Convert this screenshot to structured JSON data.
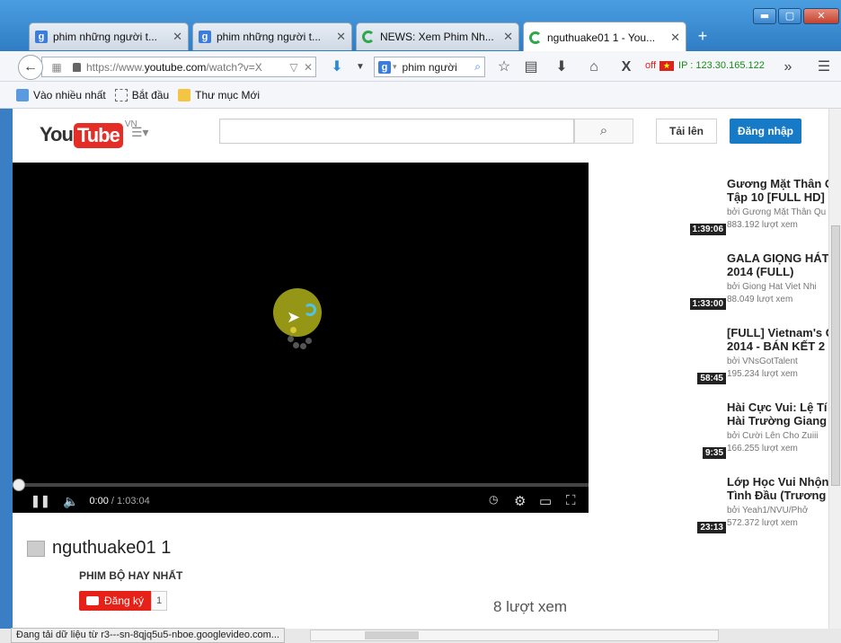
{
  "window": {
    "minimize": "▬",
    "maximize": "▢",
    "close": "✕"
  },
  "tabs": [
    {
      "label": "phim những người t...",
      "icon": "google-icon",
      "close": "✕"
    },
    {
      "label": "phim những người t...",
      "icon": "google-icon",
      "close": "✕"
    },
    {
      "label": "NEWS: Xem Phim Nh...",
      "icon": "loading-icon",
      "close": "✕"
    },
    {
      "label": "nguthuake01 1 - You...",
      "icon": "loading-icon",
      "close": "✕"
    }
  ],
  "new_tab": "+",
  "nav": {
    "url_prefix": "https://www.",
    "url_domain": "youtube.com",
    "url_suffix": "/watch?v=X",
    "search_value": "phim người",
    "ip_off": "off",
    "ip_text": "IP : 123.30.165.122",
    "more": "»",
    "menu": "☰"
  },
  "bookmarks": [
    {
      "label": "Vào nhiều nhất",
      "icon": "most-visited-icon"
    },
    {
      "label": "Bắt đầu",
      "icon": "getting-started-icon"
    },
    {
      "label": "Thư mục Mới",
      "icon": "folder-icon"
    }
  ],
  "youtube": {
    "logo_you": "You",
    "logo_tube": "Tube",
    "country": "VN",
    "upload": "Tải lên",
    "signin": "Đăng nhập"
  },
  "player": {
    "time_current": "0:00",
    "time_total": " / 1:03:04",
    "progress": 0
  },
  "recommendations": [
    {
      "title": "Gương Mặt Thân Q",
      "title2": "Tập 10 [FULL HD]",
      "user": "bởi Gương Mặt Thân Qu",
      "views": "883.192 lượt xem",
      "duration": "1:39:06"
    },
    {
      "title": "GALA GIỌNG HÁT",
      "title2": "2014 (FULL)",
      "user": "bởi Giong Hat Viet Nhi",
      "views": "88.049 lượt xem",
      "duration": "1:33:00"
    },
    {
      "title": "[FULL] Vietnam's G",
      "title2": "2014 - BÁN KẾT 2 -",
      "user": "bởi VNsGotTalent",
      "views": "195.234 lượt xem",
      "duration": "58:45"
    },
    {
      "title": "Hài Cực Vui: Lệ Tí",
      "title2": "Hài Trường Giang",
      "user": "bởi Cười Lên Cho Zuiii",
      "views": "166.255 lượt xem",
      "duration": "9:35"
    },
    {
      "title": "Lớp Học Vui Nhộn",
      "title2": "Tình Đầu (Trương",
      "user": "bởi Yeah1/NVU/Phở",
      "views": "572.372 lượt xem",
      "duration": "23:13"
    }
  ],
  "video": {
    "title": "nguthuake01 1",
    "channel": "PHIM BỘ HAY NHẤT",
    "subscribe": "Đăng ký",
    "subscribers": "1",
    "views": "8 lượt xem"
  },
  "status": "Đang tải dữ liệu từ r3---sn-8qjq5u5-nboe.googlevideo.com..."
}
